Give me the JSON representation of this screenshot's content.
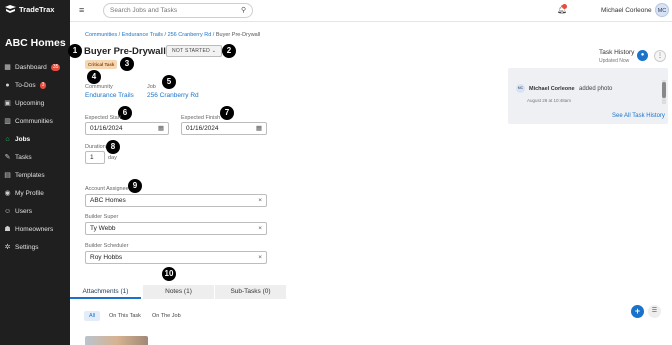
{
  "app": {
    "name": "TradeTrax",
    "company": "ABC Homes"
  },
  "sidebar": {
    "items": [
      {
        "label": "Dashboard",
        "icon": "dashboard-icon",
        "badge": "35"
      },
      {
        "label": "To-Dos",
        "icon": "check-circle-icon",
        "badge": "3"
      },
      {
        "label": "Upcoming",
        "icon": "calendar-icon"
      },
      {
        "label": "Communities",
        "icon": "building-icon"
      },
      {
        "label": "Jobs",
        "icon": "home-icon",
        "active": true
      },
      {
        "label": "Tasks",
        "icon": "wrench-icon"
      },
      {
        "label": "Templates",
        "icon": "template-icon"
      },
      {
        "label": "My Profile",
        "icon": "profile-icon"
      },
      {
        "label": "Users",
        "icon": "users-icon"
      },
      {
        "label": "Homeowners",
        "icon": "homeowners-icon"
      },
      {
        "label": "Settings",
        "icon": "gear-icon"
      }
    ]
  },
  "topbar": {
    "search_placeholder": "Search Jobs and Tasks",
    "user_name": "Michael Corleone",
    "user_initials": "MC"
  },
  "breadcrumb": {
    "c1": "Communities",
    "c2": "Endurance Trails",
    "c3": "256 Cranberry Rd",
    "current": "Buyer Pre-Drywall"
  },
  "task": {
    "title": "Buyer Pre-Drywall",
    "status": "NOT STARTED",
    "tag": "Critical Task",
    "community_label": "Community",
    "community": "Endurance Trails",
    "job_label": "Job",
    "job": "256 Cranberry Rd",
    "expected_start_label": "Expected Start",
    "expected_start": "01/16/2024",
    "expected_finish_label": "Expected Finish",
    "expected_finish": "01/16/2024",
    "duration_label": "Duration",
    "duration": "1",
    "duration_unit": "day",
    "account_assignee_label": "Account Assignee",
    "account_assignee": "ABC Homes",
    "builder_super_label": "Builder Super",
    "builder_super": "Ty Webb",
    "builder_scheduler_label": "Builder Scheduler",
    "builder_scheduler": "Roy Hobbs"
  },
  "markers": [
    "1",
    "2",
    "3",
    "4",
    "5",
    "6",
    "7",
    "8",
    "9",
    "10"
  ],
  "tabs": [
    "Attachments (1)",
    "Notes (1)",
    "Sub-Tasks (0)"
  ],
  "filters": [
    "All",
    "On This Task",
    "On The Job"
  ],
  "history": {
    "title": "Task History",
    "subtitle": "Updated Now",
    "entry_initials": "MC",
    "entry_user": "Michael Corleone",
    "entry_action": "added photo",
    "entry_date": "August 28 at 10:48am",
    "see_all": "See All Task History"
  },
  "colors": {
    "accent": "#1a73c9",
    "sidebar_bg": "#1f1f1f",
    "active_icon": "#2fbf71",
    "badge": "#e84c3d"
  }
}
